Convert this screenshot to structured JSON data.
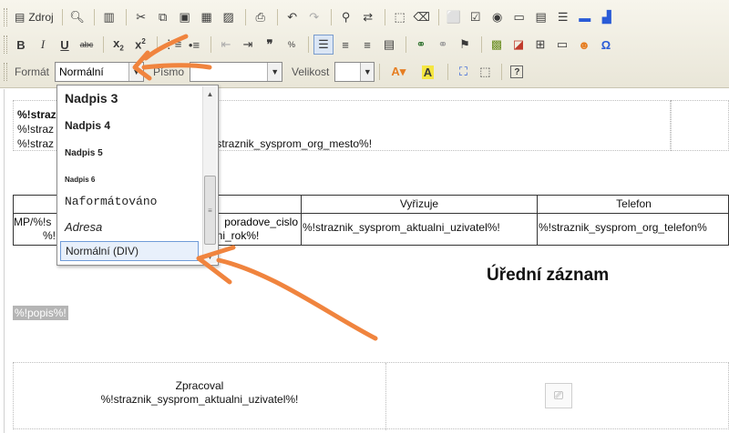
{
  "toolbar": {
    "row1": {
      "source_label": "Zdroj"
    },
    "row3": {
      "format_label": "Formát",
      "format_value": "Normální",
      "font_label": "Písmo",
      "font_value": "",
      "size_label": "Velikost",
      "size_value": ""
    }
  },
  "format_dropdown": {
    "items": [
      {
        "label": "Nadpis 3",
        "style": "h3"
      },
      {
        "label": "Nadpis 4",
        "style": "h4"
      },
      {
        "label": "Nadpis 5",
        "style": "h5"
      },
      {
        "label": "Nadpis 6",
        "style": "h6"
      },
      {
        "label": "Naformátováno",
        "style": "pre"
      },
      {
        "label": "Adresa",
        "style": "address"
      },
      {
        "label": "Normální (DIV)",
        "style": "div",
        "selected": true
      }
    ]
  },
  "document": {
    "address": {
      "line1_start": "%!straz",
      "line1_end": "!",
      "line2_start": "%!straz",
      "line3_start": "%!straz",
      "line3_end": "!straznik_sysprom_org_mesto%!"
    },
    "table": {
      "headers": [
        "",
        "Vyřizuje",
        "Telefon"
      ],
      "row_cell1_line1": "MP/%!s",
      "row_cell1_line2": "%!",
      "row_cell2_line1": "poradove_cislo",
      "row_cell2_line2": "lni_rok%!",
      "row_vyrizuje": "%!straznik_sysprom_aktualni_uzivatel%!",
      "row_telefon": "%!straznik_sysprom_org_telefon%"
    },
    "heading": "Úřední záznam",
    "popis": "%!popis%!",
    "signature": {
      "label": "Zpracoval",
      "value": "%!straznik_sysprom_aktualni_uzivatel%!"
    }
  },
  "colors": {
    "annotation_arrow": "#f0843e",
    "toolbar_bg": "#ece9d8",
    "selected_border": "#6f9bd8"
  }
}
